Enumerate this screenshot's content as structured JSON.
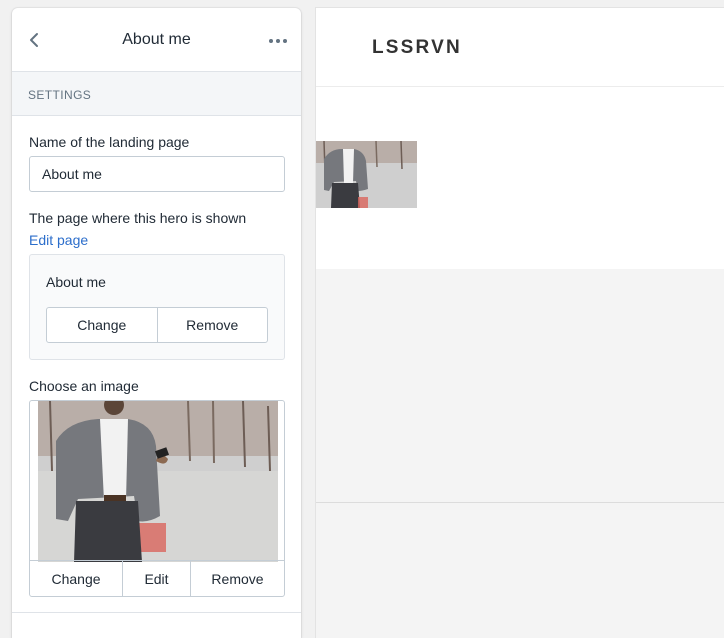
{
  "panel": {
    "title": "About me",
    "section_heading": "SETTINGS",
    "landing_name": {
      "label": "Name of the landing page",
      "value": "About me"
    },
    "hero_page": {
      "label": "The page where this hero is shown",
      "edit_link": "Edit page",
      "selected_page": "About me",
      "change_label": "Change",
      "remove_label": "Remove"
    },
    "image": {
      "label": "Choose an image",
      "change_label": "Change",
      "edit_label": "Edit",
      "remove_label": "Remove"
    }
  },
  "preview": {
    "brand": "LSSRVN"
  },
  "icons": {
    "back": "chevron-left-icon",
    "more": "ellipsis-icon"
  },
  "colors": {
    "link": "#2c6ecb",
    "border": "#c4cdd5",
    "section_bg": "#f4f6f8"
  }
}
